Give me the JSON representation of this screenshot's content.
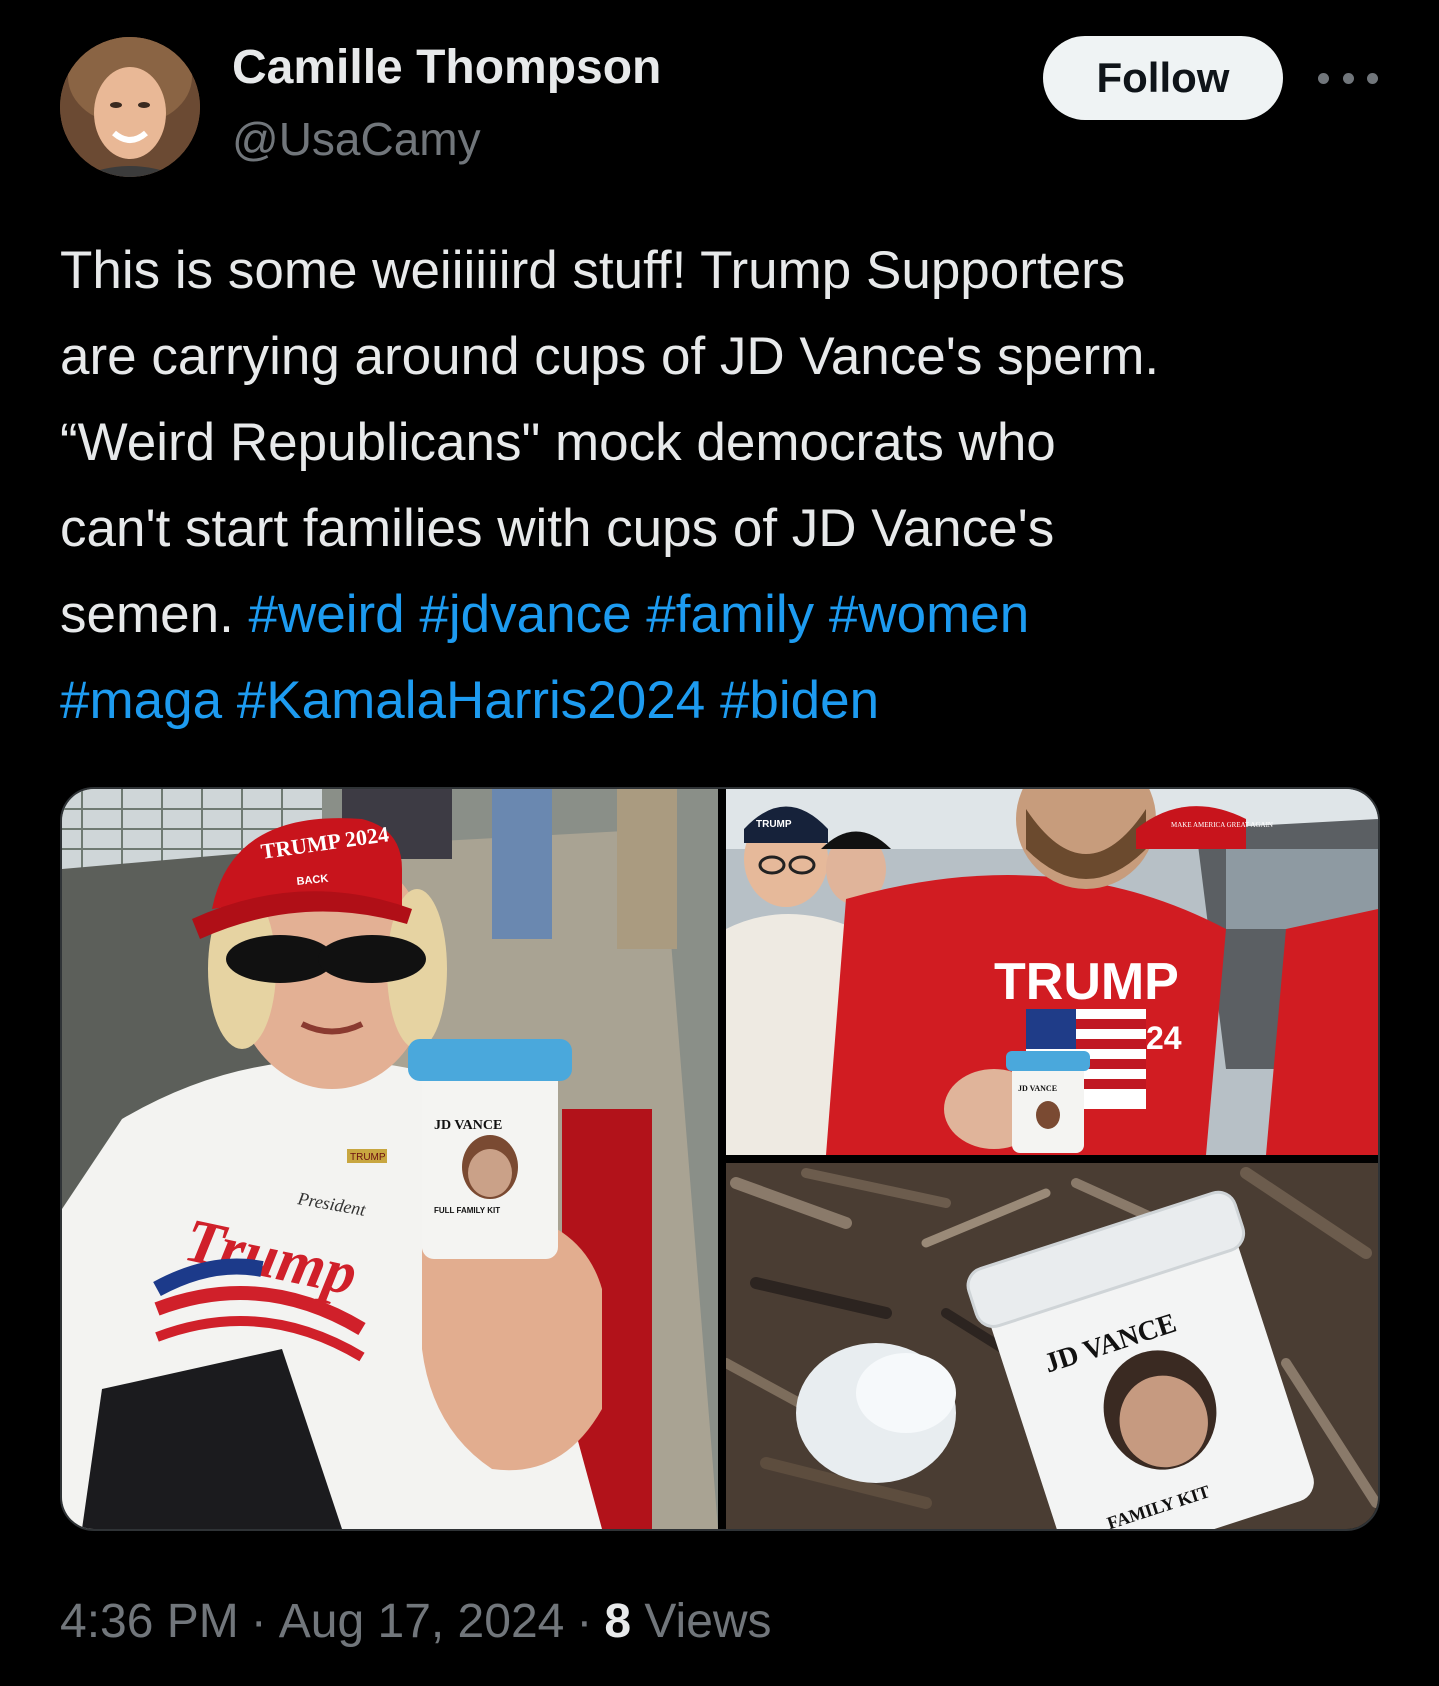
{
  "author": {
    "name": "Camille Thompson",
    "handle": "@UsaCamy"
  },
  "header": {
    "follow_label": "Follow"
  },
  "tweet": {
    "text_lines": [
      "This is some weiiiiiird stuff! Trump Supporters",
      "are carrying around cups of JD Vance's sperm.",
      "“Weird Republicans\" mock democrats who",
      "can't start families with cups of JD Vance's",
      "semen. "
    ],
    "hashtags_line5": [
      "#weird",
      "#jdvance",
      "#family",
      "#women"
    ],
    "hashtags_line6": [
      "#maga",
      "#KamalaHarris2024",
      "#biden"
    ]
  },
  "media": {
    "photo_left": {
      "cap_text": "TRUMP 2024",
      "cap_sub": "BACK",
      "shirt_text": "Trump",
      "shirt_sub": "President",
      "cup_label": "JD VANCE",
      "cup_sub": "FULL FAMILY KIT",
      "pin_text": "TRUMP"
    },
    "photo_top_right": {
      "hat_text": "TRUMP",
      "shirt_text": "TRUMP",
      "shirt_num": "24",
      "cup_label": "JD VANCE",
      "red_hat_text": "MAKE AMERICA GREAT AGAIN"
    },
    "photo_bottom_right": {
      "cup_label": "JD VANCE",
      "cup_sub": "FAMILY KIT"
    }
  },
  "footer": {
    "time": "4:36 PM",
    "date": "Aug 17, 2024",
    "views_count": "8",
    "views_label": "Views"
  },
  "colors": {
    "background": "#000000",
    "text": "#e7e9ea",
    "secondary": "#71767b",
    "link": "#1d9bf0"
  }
}
